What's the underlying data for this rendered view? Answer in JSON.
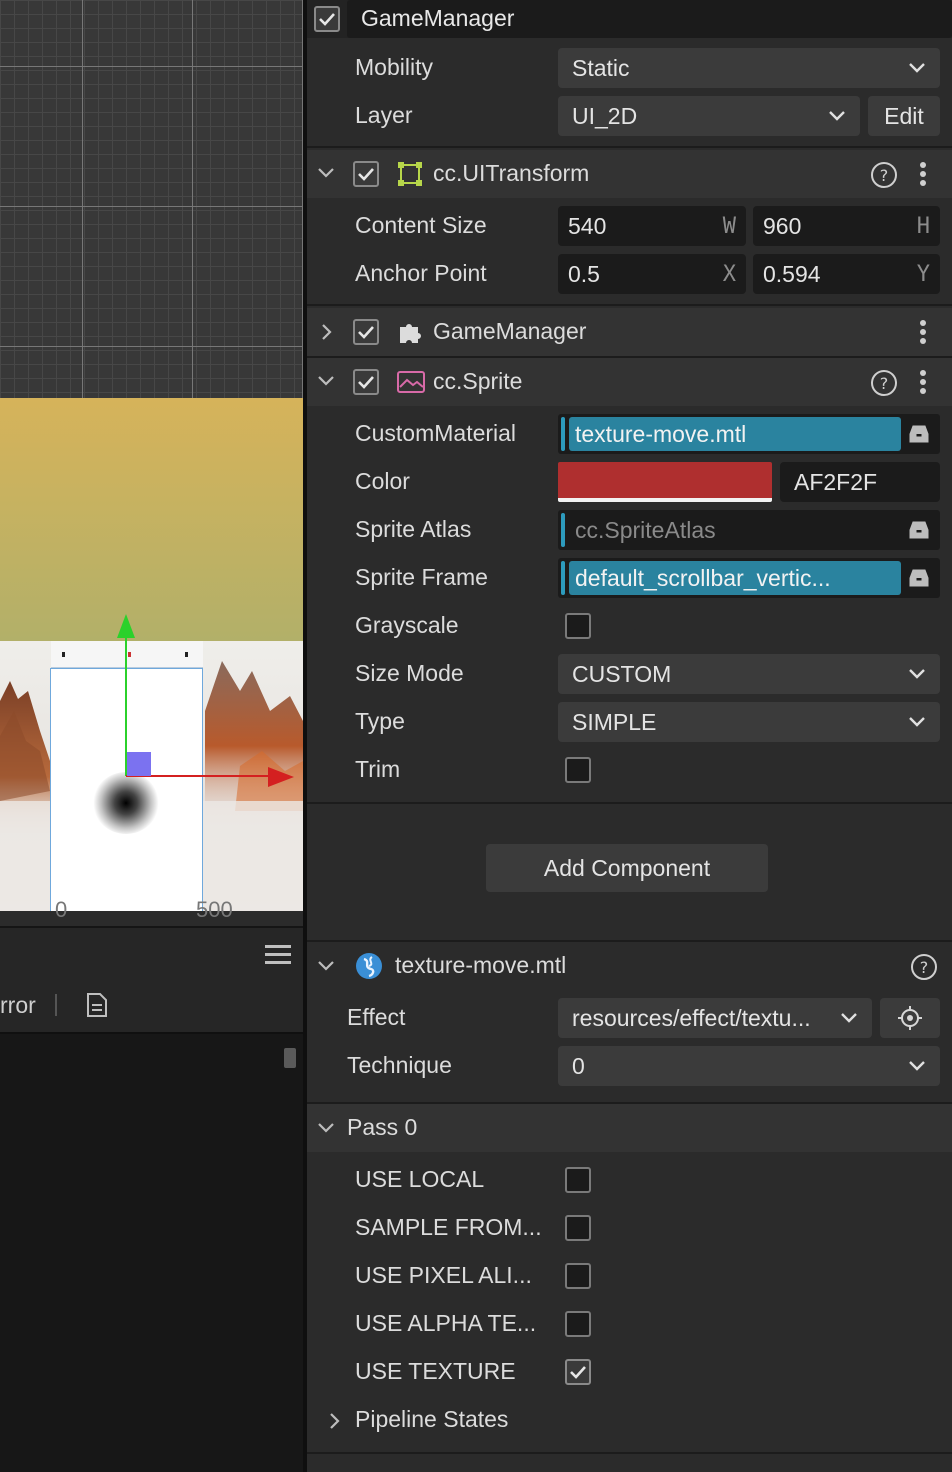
{
  "scene": {
    "ruler_start": "0",
    "ruler_end": "500"
  },
  "console": {
    "filter_label": "rror"
  },
  "inspector": {
    "node_name": "GameManager",
    "mobility": {
      "label": "Mobility",
      "value": "Static"
    },
    "layer": {
      "label": "Layer",
      "value": "UI_2D",
      "edit_label": "Edit"
    },
    "uitransform": {
      "title": "cc.UITransform",
      "content_size": {
        "label": "Content Size",
        "w": "540",
        "w_axis": "W",
        "h": "960",
        "h_axis": "H"
      },
      "anchor_point": {
        "label": "Anchor Point",
        "x": "0.5",
        "x_axis": "X",
        "y": "0.594",
        "y_axis": "Y"
      }
    },
    "script_component": {
      "title": "GameManager"
    },
    "sprite": {
      "title": "cc.Sprite",
      "custom_material": {
        "label": "CustomMaterial",
        "value": "texture-move.mtl"
      },
      "color": {
        "label": "Color",
        "hex": "AF2F2F",
        "swatch": "#AF2F2F"
      },
      "sprite_atlas": {
        "label": "Sprite Atlas",
        "value": "cc.SpriteAtlas"
      },
      "sprite_frame": {
        "label": "Sprite Frame",
        "value": "default_scrollbar_vertic..."
      },
      "grayscale": {
        "label": "Grayscale",
        "checked": false
      },
      "size_mode": {
        "label": "Size Mode",
        "value": "CUSTOM"
      },
      "type": {
        "label": "Type",
        "value": "SIMPLE"
      },
      "trim": {
        "label": "Trim",
        "checked": false
      }
    },
    "add_component_label": "Add Component",
    "material": {
      "title": "texture-move.mtl",
      "effect": {
        "label": "Effect",
        "value": "resources/effect/textu..."
      },
      "technique": {
        "label": "Technique",
        "value": "0"
      },
      "pass": {
        "title": "Pass 0",
        "options": [
          {
            "label": "USE LOCAL",
            "checked": false
          },
          {
            "label": "SAMPLE FROM...",
            "checked": false
          },
          {
            "label": "USE PIXEL ALI...",
            "checked": false
          },
          {
            "label": "USE ALPHA TE...",
            "checked": false
          },
          {
            "label": "USE TEXTURE",
            "checked": true
          }
        ],
        "pipeline_states_label": "Pipeline States"
      }
    }
  },
  "colors": {
    "accent": "#2A839F",
    "panel": "#2B2B2B",
    "header": "#333333"
  }
}
